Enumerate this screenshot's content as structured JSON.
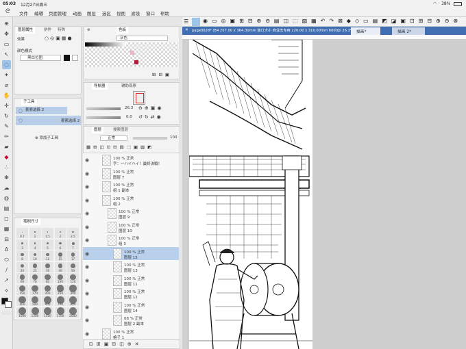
{
  "status": {
    "time": "05:03",
    "date": "12月27日周三",
    "battery": "38%"
  },
  "menu": [
    "文件",
    "编辑",
    "页面管理",
    "动画",
    "图层",
    "选区",
    "视图",
    "滤镜",
    "窗口",
    "帮助"
  ],
  "tool_panel": {
    "tabs": [
      "图层属性",
      "拼件",
      "特殊"
    ],
    "effect_label": "效果",
    "color_mode_label": "颜色模式",
    "color_mode_value": "黑白位图"
  },
  "sub_tool": {
    "tab": "子工具",
    "items": [
      "套索选择 2",
      "套索选择 2"
    ],
    "add_label": "添加子工具"
  },
  "brush_size": {
    "tab": "笔刷尺寸",
    "sizes": [
      "0.7",
      "1",
      "1.5",
      "2",
      "2.5",
      "3",
      "4",
      "5",
      "6",
      "7",
      "8",
      "10",
      "12",
      "15",
      "17",
      "20",
      "25",
      "30",
      "40",
      "50",
      "60",
      "70",
      "80",
      "100",
      "120",
      "150",
      "170",
      "200",
      "250",
      "300",
      "400",
      "500",
      "600",
      "700",
      "800",
      "1000",
      "1200",
      "1500",
      "1700",
      "2000"
    ]
  },
  "color_panel": {
    "tab": "色板",
    "mode": "灰色"
  },
  "navigator": {
    "tabs": [
      "导航器",
      "辅助观察"
    ],
    "zoom": "26.3",
    "rotate": "0.0"
  },
  "layers": {
    "tabs": [
      "图层",
      "搜索图层"
    ],
    "blend": "正常",
    "opacity": "100",
    "items": [
      {
        "top": "100 % 正常",
        "name": "字：一ハイハイ！最終決戦！",
        "depth": 0,
        "selected": false
      },
      {
        "top": "100 % 正常",
        "name": "图层 7",
        "depth": 0,
        "selected": false
      },
      {
        "top": "100 % 正常",
        "name": "组 1 副本",
        "depth": 0,
        "selected": false
      },
      {
        "top": "100 % 正常",
        "name": "组 2",
        "depth": 0,
        "selected": false
      },
      {
        "top": "100 % 正常",
        "name": "图层 9",
        "depth": 1,
        "selected": false
      },
      {
        "top": "100 % 正常",
        "name": "图层 10",
        "depth": 1,
        "selected": false
      },
      {
        "top": "100 % 正常",
        "name": "组 3",
        "depth": 1,
        "selected": false
      },
      {
        "top": "100 % 正常",
        "name": "图层 15",
        "depth": 2,
        "selected": true
      },
      {
        "top": "100 % 正常",
        "name": "图层 13",
        "depth": 2,
        "selected": false
      },
      {
        "top": "100 % 正常",
        "name": "图层 11",
        "depth": 2,
        "selected": false
      },
      {
        "top": "100 % 正常",
        "name": "图层 12",
        "depth": 2,
        "selected": false
      },
      {
        "top": "100 % 正常",
        "name": "图层 14",
        "depth": 2,
        "selected": false
      },
      {
        "top": "68 % 正常",
        "name": "图层 2 副本",
        "depth": 2,
        "selected": false
      },
      {
        "top": "100 % 正常",
        "name": "格子 1",
        "depth": 0,
        "selected": false
      }
    ]
  },
  "document": {
    "title": "page0028* (B4 257.00 x 364.00mm 装订大小 商业志专用 220.00 x 310.00mm 600dpi 26.3%)",
    "tabs": [
      "描画*",
      "描画 2*"
    ]
  },
  "colors": {
    "accent": "#3f6fb2",
    "selection": "#b9d0ec"
  }
}
